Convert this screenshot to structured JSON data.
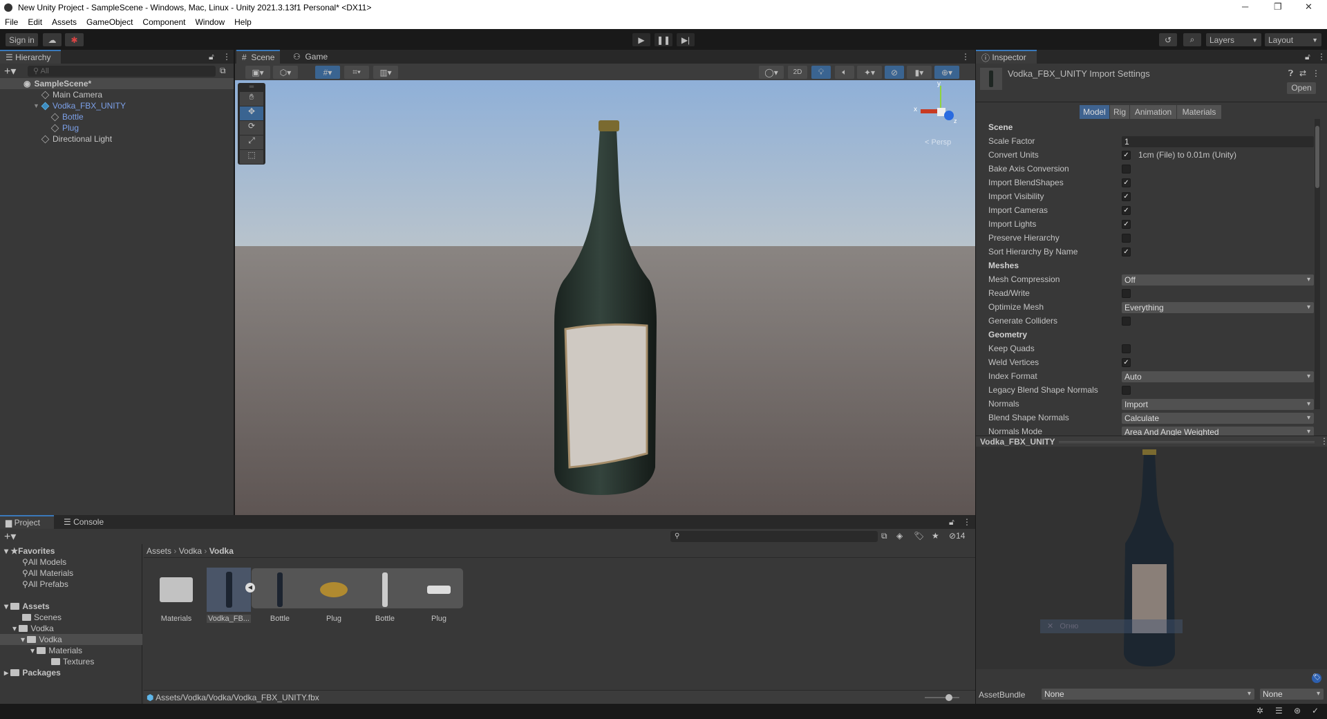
{
  "window": {
    "title": "New Unity Project - SampleScene - Windows, Mac, Linux - Unity 2021.3.13f1 Personal* <DX11>",
    "minimize": "─",
    "maximize": "❐",
    "close": "✕"
  },
  "menu": [
    "File",
    "Edit",
    "Assets",
    "GameObject",
    "Component",
    "Window",
    "Help"
  ],
  "toolbar": {
    "sign_in": "Sign in",
    "layers": "Layers",
    "layout": "Layout"
  },
  "hierarchy": {
    "tab": "Hierarchy",
    "search_placeholder": "All",
    "scene": "SampleScene*",
    "items": [
      {
        "label": "Main Camera"
      },
      {
        "label": "Vodka_FBX_UNITY"
      },
      {
        "label": "Bottle"
      },
      {
        "label": "Plug"
      },
      {
        "label": "Directional Light"
      }
    ]
  },
  "scene_view": {
    "tabs": [
      "Scene",
      "Game"
    ],
    "btn_2d": "2D",
    "gizmo": {
      "x": "x",
      "y": "y",
      "z": "z",
      "projection": "Persp"
    },
    "sky_color": "#9fb7d3",
    "ground_color": "#6e6560"
  },
  "inspector": {
    "tab": "Inspector",
    "title": "Vodka_FBX_UNITY Import Settings",
    "open": "Open",
    "tabs": [
      "Model",
      "Rig",
      "Animation",
      "Materials"
    ],
    "active_tab": "Model",
    "rows": [
      {
        "type": "header",
        "label": "Scene"
      },
      {
        "type": "field",
        "label": "Scale Factor",
        "value": "1"
      },
      {
        "type": "check",
        "label": "Convert Units",
        "checked": true,
        "note": "1cm (File) to 0.01m (Unity)"
      },
      {
        "type": "check",
        "label": "Bake Axis Conversion",
        "checked": false
      },
      {
        "type": "check",
        "label": "Import BlendShapes",
        "checked": true
      },
      {
        "type": "check",
        "label": "Import Visibility",
        "checked": true
      },
      {
        "type": "check",
        "label": "Import Cameras",
        "checked": true
      },
      {
        "type": "check",
        "label": "Import Lights",
        "checked": true
      },
      {
        "type": "check",
        "label": "Preserve Hierarchy",
        "checked": false
      },
      {
        "type": "check",
        "label": "Sort Hierarchy By Name",
        "checked": true
      },
      {
        "type": "header",
        "label": "Meshes"
      },
      {
        "type": "dropdown",
        "label": "Mesh Compression",
        "value": "Off"
      },
      {
        "type": "check",
        "label": "Read/Write",
        "checked": false
      },
      {
        "type": "dropdown",
        "label": "Optimize Mesh",
        "value": "Everything"
      },
      {
        "type": "check",
        "label": "Generate Colliders",
        "checked": false
      },
      {
        "type": "header",
        "label": "Geometry"
      },
      {
        "type": "check",
        "label": "Keep Quads",
        "checked": false
      },
      {
        "type": "check",
        "label": "Weld Vertices",
        "checked": true
      },
      {
        "type": "dropdown",
        "label": "Index Format",
        "value": "Auto"
      },
      {
        "type": "check",
        "label": "Legacy Blend Shape Normals",
        "checked": false
      },
      {
        "type": "dropdown",
        "label": "Normals",
        "value": "Import"
      },
      {
        "type": "dropdown",
        "label": "Blend Shape Normals",
        "value": "Calculate"
      },
      {
        "type": "dropdown",
        "label": "Normals Mode",
        "value": "Area And Angle Weighted"
      }
    ],
    "preview_title": "Vodka_FBX_UNITY",
    "preview_overlay": "Огню",
    "assetbundle_label": "AssetBundle",
    "assetbundle_value": "None",
    "assetbundle_variant": "None"
  },
  "project": {
    "tabs": [
      "Project",
      "Console"
    ],
    "hidden_count": "14",
    "tree": [
      {
        "label": "Favorites",
        "bold": true
      },
      {
        "label": "All Models"
      },
      {
        "label": "All Materials"
      },
      {
        "label": "All Prefabs"
      },
      {
        "label": "Assets",
        "bold": true
      },
      {
        "label": "Scenes"
      },
      {
        "label": "Vodka"
      },
      {
        "label": "Vodka"
      },
      {
        "label": "Materials"
      },
      {
        "label": "Textures"
      },
      {
        "label": "Packages",
        "bold": true
      }
    ],
    "breadcrumb": [
      "Assets",
      "Vodka",
      "Vodka"
    ],
    "assets": [
      "Materials",
      "Vodka_FB...",
      "Bottle",
      "Plug",
      "Bottle",
      "Plug"
    ],
    "path": "Assets/Vodka/Vodka/Vodka_FBX_UNITY.fbx"
  }
}
